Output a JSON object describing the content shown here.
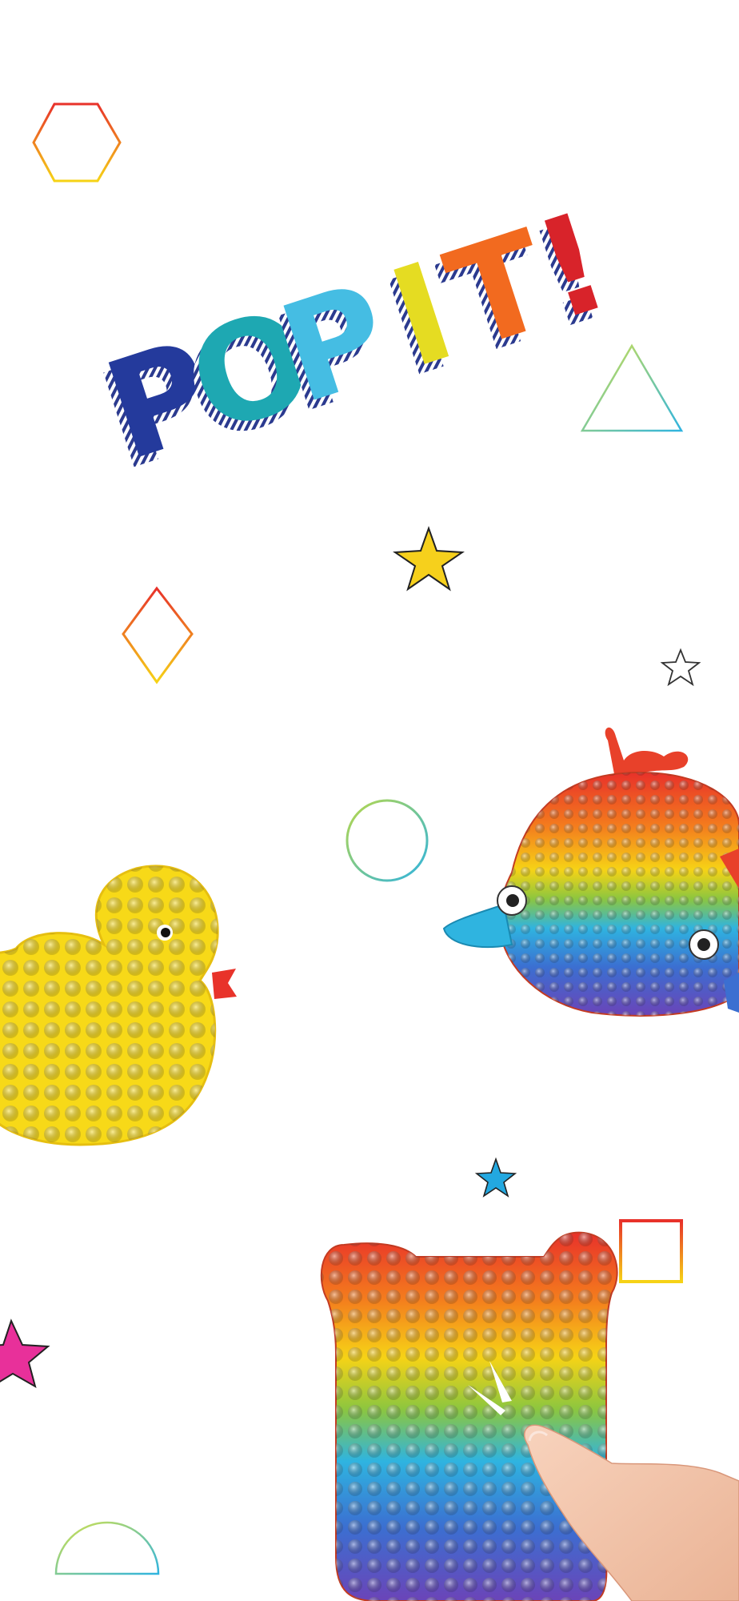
{
  "title": {
    "text": "POP IT!",
    "letters": [
      {
        "char": "P",
        "color": "#243a9c"
      },
      {
        "char": "O",
        "color": "#1ea8b2"
      },
      {
        "char": "P",
        "color": "#45bde3"
      },
      {
        "char": "I",
        "color": "#e5dc22"
      },
      {
        "char": "T",
        "color": "#f26a1f"
      },
      {
        "char": "!",
        "color": "#d8232a"
      }
    ]
  },
  "colors": {
    "background": "#ffffff",
    "rainbow": [
      "#e8312a",
      "#f47c1d",
      "#f6d316",
      "#8cc63f",
      "#2fb4e0",
      "#3b6fd1",
      "#6b44b8"
    ],
    "duck": "#f7d918",
    "duck_beak": "#e8332a",
    "star_yellow": "#f6d01c",
    "star_blue": "#23a8e0",
    "star_pink": "#e8309a"
  },
  "toys": [
    {
      "name": "duck",
      "kind": "pop-it"
    },
    {
      "name": "whale",
      "kind": "pop-it"
    },
    {
      "name": "bear",
      "kind": "pop-it"
    }
  ],
  "decorations": [
    "hexagon-outline",
    "triangle-outline",
    "star-yellow",
    "diamond-outline",
    "star-outline",
    "circle-outline",
    "star-blue",
    "square-outline",
    "star-pink",
    "semicircle-outline"
  ]
}
